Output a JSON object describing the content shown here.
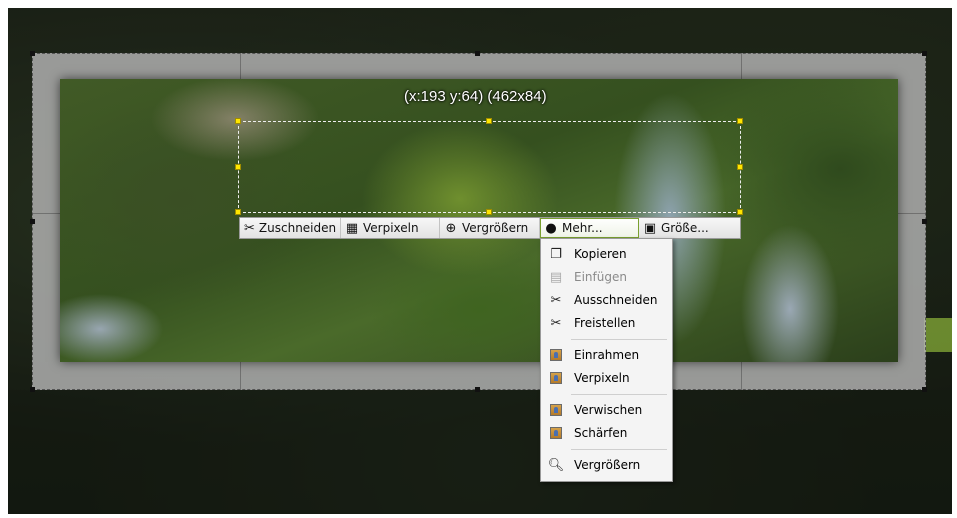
{
  "overlay": {
    "coord_label": "(x:193 y:64) (462x84)"
  },
  "toolbar": {
    "buttons": [
      {
        "label": "Zuschneiden",
        "icon": "scissors-icon"
      },
      {
        "label": "Verpixeln",
        "icon": "pixelate-icon"
      },
      {
        "label": "Vergrößern",
        "icon": "zoom-icon"
      },
      {
        "label": "Mehr...",
        "icon": "plus-circle-icon"
      },
      {
        "label": "Größe...",
        "icon": "resize-icon"
      }
    ]
  },
  "menu": {
    "items": [
      {
        "label": "Kopieren",
        "icon": "copy-icon",
        "enabled": true
      },
      {
        "label": "Einfügen",
        "icon": "paste-icon",
        "enabled": false
      },
      {
        "label": "Ausschneiden",
        "icon": "scissors-icon",
        "enabled": true
      },
      {
        "label": "Freistellen",
        "icon": "scissors-icon",
        "enabled": true
      },
      {
        "label": "Einrahmen",
        "icon": "image-effect-icon",
        "enabled": true
      },
      {
        "label": "Verpixeln",
        "icon": "image-effect-icon",
        "enabled": true
      },
      {
        "label": "Verwischen",
        "icon": "image-effect-icon",
        "enabled": true
      },
      {
        "label": "Schärfen",
        "icon": "image-effect-icon",
        "enabled": true
      },
      {
        "label": "Vergrößern",
        "icon": "magnifier-icon",
        "enabled": true
      }
    ]
  },
  "colors": {
    "selection_handle": "#ffe600",
    "active_outline": "#7aa02f"
  }
}
